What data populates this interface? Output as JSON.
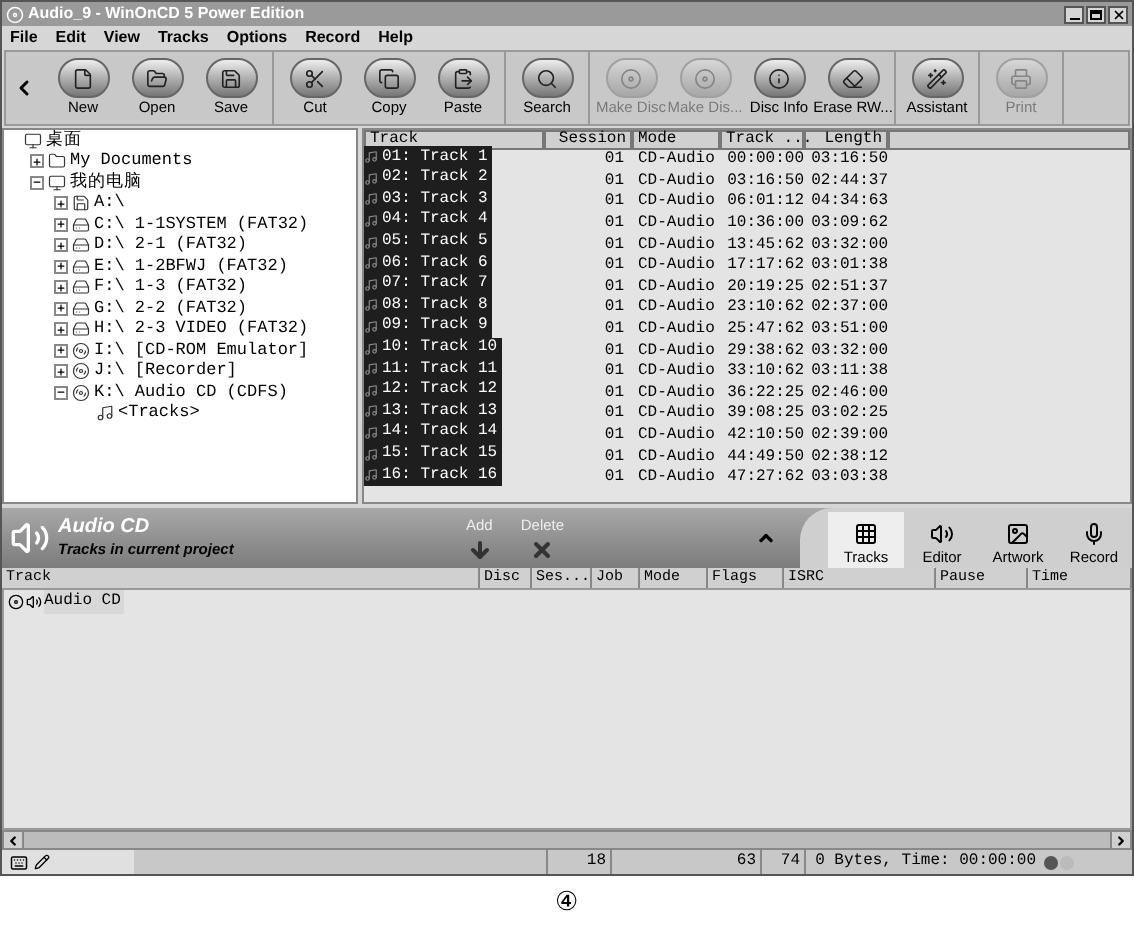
{
  "window": {
    "title": "Audio_9 - WinOnCD 5 Power Edition"
  },
  "menu": [
    "File",
    "Edit",
    "View",
    "Tracks",
    "Options",
    "Record",
    "Help"
  ],
  "toolbar": [
    [
      {
        "label": "New",
        "disabled": false
      },
      {
        "label": "Open",
        "disabled": false
      },
      {
        "label": "Save",
        "disabled": false
      }
    ],
    [
      {
        "label": "Cut",
        "disabled": false
      },
      {
        "label": "Copy",
        "disabled": false
      },
      {
        "label": "Paste",
        "disabled": false
      }
    ],
    [
      {
        "label": "Search",
        "disabled": false
      }
    ],
    [
      {
        "label": "Make Disc",
        "disabled": true
      },
      {
        "label": "Make Dis...",
        "disabled": true
      },
      {
        "label": "Disc Info",
        "disabled": false
      },
      {
        "label": "Erase RW...",
        "disabled": false
      }
    ],
    [
      {
        "label": "Assistant",
        "disabled": false
      }
    ],
    [
      {
        "label": "Print",
        "disabled": true
      }
    ]
  ],
  "tree": [
    {
      "label": "桌面",
      "kind": "desktop",
      "children": [
        {
          "label": "My Documents",
          "kind": "folder",
          "expanded": false
        },
        {
          "label": "我的电脑",
          "kind": "computer",
          "expanded": true,
          "children": [
            {
              "label": "A:\\",
              "kind": "floppy",
              "expanded": false
            },
            {
              "label": "C:\\ 1-1SYSTEM (FAT32)",
              "kind": "drive",
              "expanded": false
            },
            {
              "label": "D:\\ 2-1 (FAT32)",
              "kind": "drive",
              "expanded": false
            },
            {
              "label": "E:\\ 1-2BFWJ (FAT32)",
              "kind": "drive",
              "expanded": false
            },
            {
              "label": "F:\\ 1-3 (FAT32)",
              "kind": "drive",
              "expanded": false
            },
            {
              "label": "G:\\ 2-2 (FAT32)",
              "kind": "drive",
              "expanded": false
            },
            {
              "label": "H:\\ 2-3 VIDEO (FAT32)",
              "kind": "drive",
              "expanded": false
            },
            {
              "label": "I:\\ [CD-ROM Emulator]",
              "kind": "cd",
              "expanded": false
            },
            {
              "label": "J:\\ [Recorder]",
              "kind": "cd",
              "expanded": false
            },
            {
              "label": "K:\\ Audio CD (CDFS)",
              "kind": "cd",
              "expanded": true,
              "children": [
                {
                  "label": "<Tracks>",
                  "kind": "audio"
                }
              ]
            }
          ]
        }
      ]
    }
  ],
  "track_list": {
    "columns": [
      "Track",
      "Session",
      "Mode",
      "Track ...",
      "Length"
    ],
    "rows": [
      {
        "track": "01: Track 1",
        "session": "01",
        "mode": "CD-Audio",
        "start": "00:00:00",
        "length": "03:16:50",
        "selected": true
      },
      {
        "track": "02: Track 2",
        "session": "01",
        "mode": "CD-Audio",
        "start": "03:16:50",
        "length": "02:44:37",
        "selected": true
      },
      {
        "track": "03: Track 3",
        "session": "01",
        "mode": "CD-Audio",
        "start": "06:01:12",
        "length": "04:34:63",
        "selected": true
      },
      {
        "track": "04: Track 4",
        "session": "01",
        "mode": "CD-Audio",
        "start": "10:36:00",
        "length": "03:09:62",
        "selected": true
      },
      {
        "track": "05: Track 5",
        "session": "01",
        "mode": "CD-Audio",
        "start": "13:45:62",
        "length": "03:32:00",
        "selected": true
      },
      {
        "track": "06: Track 6",
        "session": "01",
        "mode": "CD-Audio",
        "start": "17:17:62",
        "length": "03:01:38",
        "selected": true
      },
      {
        "track": "07: Track 7",
        "session": "01",
        "mode": "CD-Audio",
        "start": "20:19:25",
        "length": "02:51:37",
        "selected": true
      },
      {
        "track": "08: Track 8",
        "session": "01",
        "mode": "CD-Audio",
        "start": "23:10:62",
        "length": "02:37:00",
        "selected": true
      },
      {
        "track": "09: Track 9",
        "session": "01",
        "mode": "CD-Audio",
        "start": "25:47:62",
        "length": "03:51:00",
        "selected": true
      },
      {
        "track": "10: Track 10",
        "session": "01",
        "mode": "CD-Audio",
        "start": "29:38:62",
        "length": "03:32:00",
        "selected": true
      },
      {
        "track": "11: Track 11",
        "session": "01",
        "mode": "CD-Audio",
        "start": "33:10:62",
        "length": "03:11:38",
        "selected": true
      },
      {
        "track": "12: Track 12",
        "session": "01",
        "mode": "CD-Audio",
        "start": "36:22:25",
        "length": "02:46:00",
        "selected": true
      },
      {
        "track": "13: Track 13",
        "session": "01",
        "mode": "CD-Audio",
        "start": "39:08:25",
        "length": "03:02:25",
        "selected": true
      },
      {
        "track": "14: Track 14",
        "session": "01",
        "mode": "CD-Audio",
        "start": "42:10:50",
        "length": "02:39:00",
        "selected": true
      },
      {
        "track": "15: Track 15",
        "session": "01",
        "mode": "CD-Audio",
        "start": "44:49:50",
        "length": "02:38:12",
        "selected": true
      },
      {
        "track": "16: Track 16",
        "session": "01",
        "mode": "CD-Audio",
        "start": "47:27:62",
        "length": "03:03:38",
        "selected": true
      }
    ]
  },
  "project": {
    "title": "Audio CD",
    "subtitle": "Tracks in current project",
    "actions": [
      "Add",
      "Delete"
    ],
    "tabs": [
      {
        "label": "Tracks",
        "selected": true
      },
      {
        "label": "Editor",
        "selected": false
      },
      {
        "label": "Artwork",
        "selected": false
      },
      {
        "label": "Record",
        "selected": false
      }
    ],
    "columns": [
      "Track",
      "Disc",
      "Ses...",
      "Job",
      "Mode",
      "Flags",
      "ISRC",
      "Pause",
      "Time"
    ],
    "rows": [
      {
        "track": "Audio CD"
      }
    ]
  },
  "status_bar": [
    "18",
    "63",
    "74",
    "0 Bytes, Time: 00:00:00"
  ],
  "caption": "④"
}
